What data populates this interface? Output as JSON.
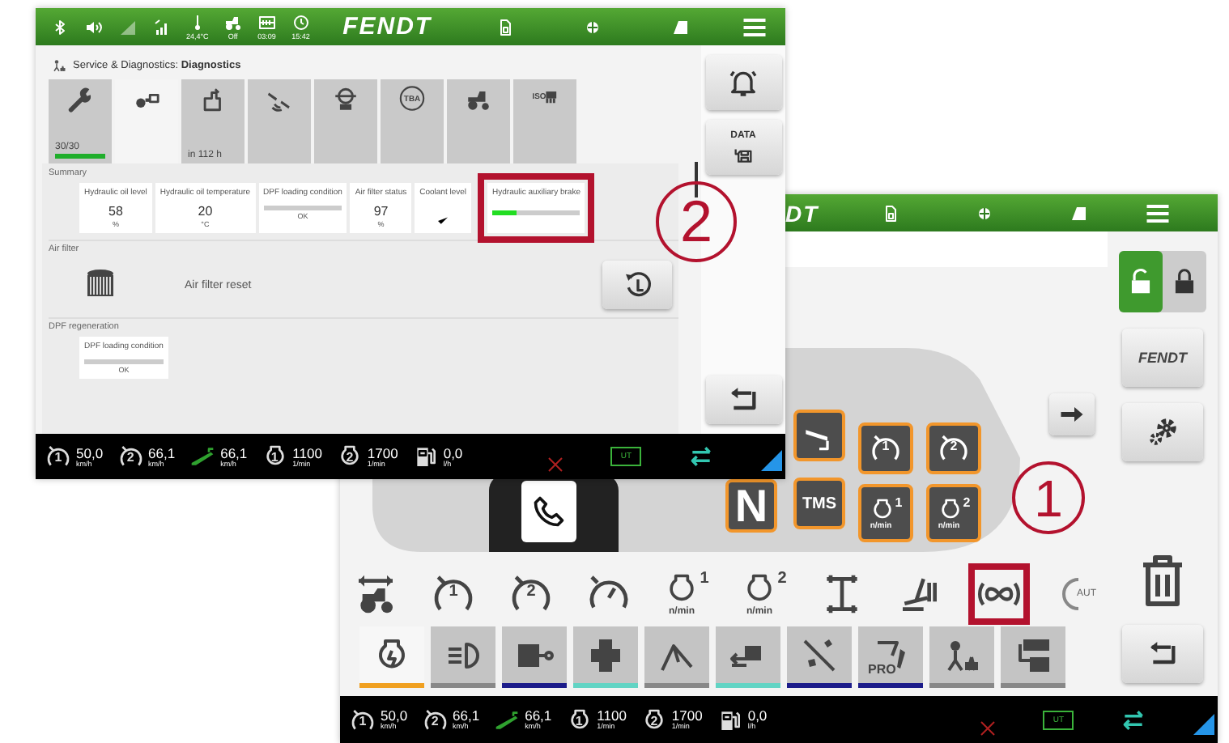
{
  "diagnostics_screen": {
    "status_bar": {
      "icons": [
        {
          "kind": "bluetooth"
        },
        {
          "kind": "volume"
        },
        {
          "kind": "signal"
        },
        {
          "kind": "signal_alt"
        },
        {
          "kind": "thermometer",
          "caption": "24,4°C"
        },
        {
          "kind": "tractor",
          "caption": "Off"
        },
        {
          "kind": "battery",
          "caption": "03:09"
        },
        {
          "kind": "clock",
          "caption": "15:42"
        }
      ],
      "logo": "FENDT",
      "right_icons": [
        {
          "kind": "sim"
        },
        {
          "kind": "globe"
        },
        {
          "kind": "field"
        },
        {
          "kind": "menu"
        }
      ]
    },
    "breadcrumb": "Service & Diagnostics: **Diagnostics**",
    "tabs": [
      {
        "kind": "wrench",
        "selected": false,
        "caption": "30/30",
        "level": 1.0
      },
      {
        "kind": "camera",
        "selected": true
      },
      {
        "kind": "service",
        "selected": false,
        "caption": "in 112 h"
      },
      {
        "kind": "gps",
        "selected": false
      },
      {
        "kind": "axle",
        "selected": false
      },
      {
        "kind": "tba",
        "selected": false,
        "icon_text": "TBA"
      },
      {
        "kind": "tractor",
        "selected": false
      },
      {
        "kind": "isobus",
        "selected": false,
        "icon_text": "ISO"
      }
    ],
    "sections": [
      {
        "kind": "tiles",
        "title": "Summary",
        "tiles": [
          {
            "kind": "value",
            "label": "Hydraulic oil level",
            "value": "58",
            "unit": "%"
          },
          {
            "kind": "value",
            "label": "Hydraulic oil temperature",
            "value": "20",
            "unit": "°C"
          },
          {
            "kind": "bar",
            "label": "DPF loading condition",
            "level": 0,
            "status": "OK"
          },
          {
            "kind": "value",
            "label": "Air filter status",
            "value": "97",
            "unit": "%"
          },
          {
            "kind": "check",
            "label": "Coolant level"
          },
          {
            "kind": "bar",
            "label": "Hydraulic auxiliary brake",
            "level": 0.28,
            "highlighted": true
          }
        ]
      },
      {
        "kind": "action",
        "title": "Air filter",
        "label": "Air filter reset"
      },
      {
        "kind": "tiles",
        "title": "DPF regeneration",
        "tiles": [
          {
            "kind": "bar",
            "label": "DPF loading condition",
            "level": 0,
            "status": "OK"
          }
        ]
      }
    ],
    "side_buttons": [
      {
        "kind": "bell"
      },
      {
        "kind": "data",
        "text": "DATA"
      },
      {
        "kind": "spacer"
      },
      {
        "kind": "back"
      }
    ],
    "readings": [
      {
        "kind": "cruise",
        "number": "1",
        "value": "50,0",
        "unit": "km/h"
      },
      {
        "kind": "cruise",
        "number": "2",
        "value": "66,1",
        "unit": "km/h"
      },
      {
        "kind": "ground",
        "value": "66,1",
        "unit": "km/h"
      },
      {
        "kind": "engine",
        "number": "1",
        "value": "1100",
        "unit": "1/min"
      },
      {
        "kind": "engine",
        "number": "2",
        "value": "1700",
        "unit": "1/min"
      },
      {
        "kind": "fuel",
        "value": "0,0",
        "unit": "l/h"
      }
    ],
    "status": {
      "ut": "UT"
    }
  },
  "control_screen": {
    "status_bar": {
      "logo": "DT",
      "right_icons": [
        {
          "kind": "sim"
        },
        {
          "kind": "globe"
        },
        {
          "kind": "field"
        },
        {
          "kind": "menu"
        }
      ]
    },
    "lock": {
      "unlocked": true
    },
    "side_buttons": [
      {
        "kind": "brand",
        "text": "FENDT"
      },
      {
        "kind": "gear"
      }
    ],
    "console": [
      {
        "kind": "neutral",
        "text": "N"
      },
      {
        "kind": "pedal"
      },
      {
        "kind": "tms",
        "text": "TMS"
      },
      {
        "kind": "cruise",
        "number": "1"
      },
      {
        "kind": "cruise",
        "number": "2"
      },
      {
        "kind": "engine",
        "number": "1",
        "unit": "n/min"
      },
      {
        "kind": "engine",
        "number": "2",
        "unit": "n/min"
      }
    ],
    "function_icons": [
      {
        "kind": "width"
      },
      {
        "kind": "cruise",
        "number": "1"
      },
      {
        "kind": "cruise",
        "number": "2"
      },
      {
        "kind": "speedo"
      },
      {
        "kind": "engine",
        "number": "1",
        "unit": "n/min"
      },
      {
        "kind": "engine",
        "number": "2",
        "unit": "n/min"
      },
      {
        "kind": "steering"
      },
      {
        "kind": "pedal_switch"
      },
      {
        "kind": "infinity",
        "highlighted": true
      },
      {
        "kind": "auto",
        "icon_text": "AUT"
      }
    ],
    "tabs": [
      {
        "kind": "engine_tab",
        "selected": true,
        "color": "#f0a020"
      },
      {
        "kind": "light",
        "selected": false,
        "color": "#888888"
      },
      {
        "kind": "hitch",
        "selected": false,
        "color": "#1c1c8a"
      },
      {
        "kind": "pto",
        "selected": false,
        "color": "#62d4c4"
      },
      {
        "kind": "wiper",
        "selected": false,
        "color": "#888888"
      },
      {
        "kind": "valves",
        "selected": false,
        "color": "#62d4c4"
      },
      {
        "kind": "tools",
        "selected": false,
        "color": "#1c1c8a"
      },
      {
        "kind": "pro",
        "selected": false,
        "color": "#1c1c8a",
        "icon_text": "PRO"
      },
      {
        "kind": "implement",
        "selected": false,
        "color": "#888888"
      },
      {
        "kind": "display",
        "selected": false,
        "color": "#888888"
      }
    ],
    "readings": [
      {
        "kind": "cruise",
        "number": "1",
        "value": "50,0",
        "unit": "km/h"
      },
      {
        "kind": "cruise",
        "number": "2",
        "value": "66,1",
        "unit": "km/h"
      },
      {
        "kind": "ground",
        "value": "66,1",
        "unit": "km/h"
      },
      {
        "kind": "engine",
        "number": "1",
        "value": "1100",
        "unit": "1/min"
      },
      {
        "kind": "engine",
        "number": "2",
        "value": "1700",
        "unit": "1/min"
      },
      {
        "kind": "fuel",
        "value": "0,0",
        "unit": "l/h"
      }
    ],
    "status": {
      "ut": "UT"
    }
  },
  "annotations": [
    {
      "label": "2"
    },
    {
      "label": "1"
    }
  ]
}
